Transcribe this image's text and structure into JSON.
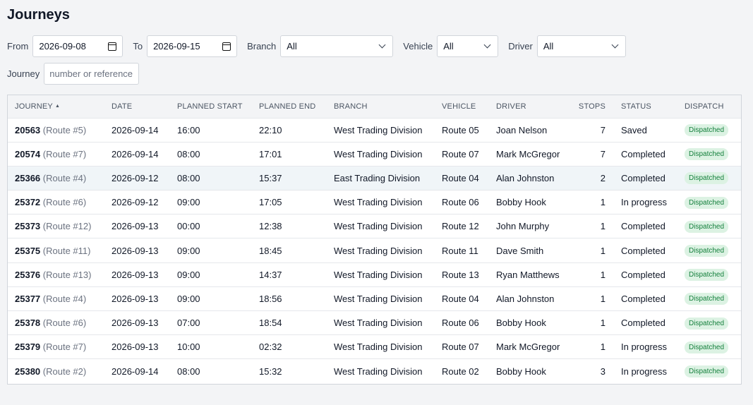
{
  "page": {
    "title": "Journeys"
  },
  "filters": {
    "from_label": "From",
    "from_value": "2026-09-08",
    "to_label": "To",
    "to_value": "2026-09-15",
    "branch_label": "Branch",
    "branch_value": "All",
    "vehicle_label": "Vehicle",
    "vehicle_value": "All",
    "driver_label": "Driver",
    "driver_value": "All",
    "journey_label": "Journey",
    "journey_placeholder": "number or reference"
  },
  "table": {
    "columns": [
      "Journey",
      "Date",
      "Planned start",
      "Planned end",
      "Branch",
      "Vehicle",
      "Driver",
      "Stops",
      "Status",
      "Dispatch"
    ],
    "sort_indicator": "▲",
    "rows": [
      {
        "id": "20563",
        "route": "(Route #5)",
        "date": "2026-09-14",
        "start": "16:00",
        "end": "22:10",
        "branch": "West Trading Division",
        "vehicle": "Route 05",
        "driver": "Joan Nelson",
        "stops": "7",
        "status": "Saved",
        "dispatch": "Dispatched"
      },
      {
        "id": "20574",
        "route": "(Route #7)",
        "date": "2026-09-14",
        "start": "08:00",
        "end": "17:01",
        "branch": "West Trading Division",
        "vehicle": "Route 07",
        "driver": "Mark McGregor",
        "stops": "7",
        "status": "Completed",
        "dispatch": "Dispatched"
      },
      {
        "id": "25366",
        "route": "(Route #4)",
        "date": "2026-09-12",
        "start": "08:00",
        "end": "15:37",
        "branch": "East Trading Division",
        "vehicle": "Route 04",
        "driver": "Alan Johnston",
        "stops": "2",
        "status": "Completed",
        "dispatch": "Dispatched"
      },
      {
        "id": "25372",
        "route": "(Route #6)",
        "date": "2026-09-12",
        "start": "09:00",
        "end": "17:05",
        "branch": "West Trading Division",
        "vehicle": "Route 06",
        "driver": "Bobby Hook",
        "stops": "1",
        "status": "In progress",
        "dispatch": "Dispatched"
      },
      {
        "id": "25373",
        "route": "(Route #12)",
        "date": "2026-09-13",
        "start": "00:00",
        "end": "12:38",
        "branch": "West Trading Division",
        "vehicle": "Route 12",
        "driver": "John Murphy",
        "stops": "1",
        "status": "Completed",
        "dispatch": "Dispatched"
      },
      {
        "id": "25375",
        "route": "(Route #11)",
        "date": "2026-09-13",
        "start": "09:00",
        "end": "18:45",
        "branch": "West Trading Division",
        "vehicle": "Route 11",
        "driver": "Dave Smith",
        "stops": "1",
        "status": "Completed",
        "dispatch": "Dispatched"
      },
      {
        "id": "25376",
        "route": "(Route #13)",
        "date": "2026-09-13",
        "start": "09:00",
        "end": "14:37",
        "branch": "West Trading Division",
        "vehicle": "Route 13",
        "driver": "Ryan Matthews",
        "stops": "1",
        "status": "Completed",
        "dispatch": "Dispatched"
      },
      {
        "id": "25377",
        "route": "(Route #4)",
        "date": "2026-09-13",
        "start": "09:00",
        "end": "18:56",
        "branch": "West Trading Division",
        "vehicle": "Route 04",
        "driver": "Alan Johnston",
        "stops": "1",
        "status": "Completed",
        "dispatch": "Dispatched"
      },
      {
        "id": "25378",
        "route": "(Route #6)",
        "date": "2026-09-13",
        "start": "07:00",
        "end": "18:54",
        "branch": "West Trading Division",
        "vehicle": "Route 06",
        "driver": "Bobby Hook",
        "stops": "1",
        "status": "Completed",
        "dispatch": "Dispatched"
      },
      {
        "id": "25379",
        "route": "(Route #7)",
        "date": "2026-09-13",
        "start": "10:00",
        "end": "02:32",
        "branch": "West Trading Division",
        "vehicle": "Route 07",
        "driver": "Mark McGregor",
        "stops": "1",
        "status": "In progress",
        "dispatch": "Dispatched"
      },
      {
        "id": "25380",
        "route": "(Route #2)",
        "date": "2026-09-14",
        "start": "08:00",
        "end": "15:32",
        "branch": "West Trading Division",
        "vehicle": "Route 02",
        "driver": "Bobby Hook",
        "stops": "3",
        "status": "In progress",
        "dispatch": "Dispatched"
      }
    ],
    "highlighted_row": 2
  },
  "colors": {
    "badge_bg": "#dcf2e3",
    "badge_text": "#15803d",
    "row_highlight": "#f0f5f8"
  }
}
